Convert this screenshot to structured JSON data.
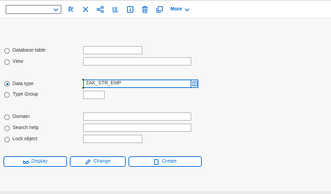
{
  "toolbar": {
    "object_select_value": "",
    "more_label": "More",
    "icons": [
      "other-object-icon",
      "where-used-icon",
      "hierarchy-icon",
      "display-list-icon",
      "info-icon",
      "delete-icon",
      "copy-icon"
    ]
  },
  "form": {
    "options": [
      {
        "label": "Database table",
        "value": "",
        "checked": false
      },
      {
        "label": "View",
        "value": "",
        "checked": false
      },
      {
        "label": "Data type",
        "value": "ZAK_STR_EMP",
        "checked": true
      },
      {
        "label": "Type Group",
        "value": "",
        "checked": false
      },
      {
        "label": "Domain",
        "value": "",
        "checked": false
      },
      {
        "label": "Search help",
        "value": "",
        "checked": false
      },
      {
        "label": "Lock object",
        "value": "",
        "checked": false
      }
    ]
  },
  "buttons": {
    "display": "Display",
    "change": "Change",
    "create": "Create"
  },
  "colors": {
    "accent": "#0a6ed1",
    "text": "#32363a",
    "background": "#f7f7f7"
  }
}
